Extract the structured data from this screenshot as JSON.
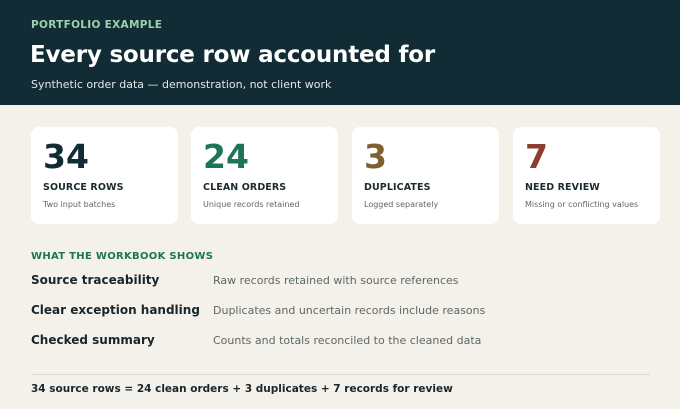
{
  "header": {
    "eyebrow": "PORTFOLIO EXAMPLE",
    "title": "Every source row accounted for",
    "subtitle": "Synthetic order data — demonstration, not client work"
  },
  "stats": [
    {
      "value": "34",
      "label": "SOURCE ROWS",
      "description": "Two input batches",
      "color": "#122c36"
    },
    {
      "value": "24",
      "label": "CLEAN ORDERS",
      "description": "Unique records retained",
      "color": "#1e7456"
    },
    {
      "value": "3",
      "label": "DUPLICATES",
      "description": "Logged separately",
      "color": "#7d6230"
    },
    {
      "value": "7",
      "label": "NEED REVIEW",
      "description": "Missing or conflicting values",
      "color": "#8e3e2e"
    }
  ],
  "features": {
    "heading": "WHAT THE WORKBOOK SHOWS",
    "items": [
      {
        "label": "Source traceability",
        "description": "Raw records retained with source references"
      },
      {
        "label": "Clear exception handling",
        "description": "Duplicates and uncertain records include reasons"
      },
      {
        "label": "Checked summary",
        "description": "Counts and totals reconciled to the cleaned data"
      }
    ]
  },
  "summary": "34 source rows = 24 clean orders + 3 duplicates + 7 records for review"
}
